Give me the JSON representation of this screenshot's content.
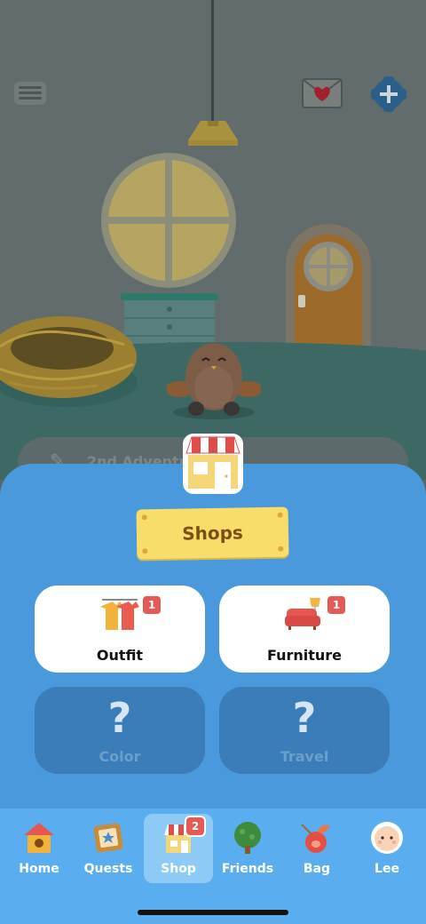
{
  "scene": {
    "adventure_text": "2nd Adventu"
  },
  "sheet": {
    "title": "Shops",
    "cards": [
      {
        "label": "Outfit",
        "badge": "1",
        "locked": false,
        "icon": "outfit-icon"
      },
      {
        "label": "Furniture",
        "badge": "1",
        "locked": false,
        "icon": "furniture-icon"
      },
      {
        "label": "Color",
        "locked": true,
        "icon": "question-icon"
      },
      {
        "label": "Travel",
        "locked": true,
        "icon": "question-icon"
      }
    ]
  },
  "tabbar": {
    "items": [
      {
        "label": "Home",
        "icon": "birdhouse-icon"
      },
      {
        "label": "Quests",
        "icon": "quest-board-icon"
      },
      {
        "label": "Shop",
        "icon": "shop-icon",
        "badge": "2",
        "active": true
      },
      {
        "label": "Friends",
        "icon": "tree-icon"
      },
      {
        "label": "Bag",
        "icon": "bag-icon"
      },
      {
        "label": "Lee",
        "icon": "avatar-icon"
      }
    ]
  },
  "colors": {
    "sheet_blue": "#4a99dc",
    "tabbar_blue": "#5aaef0",
    "sign_yellow": "#f8dd6b",
    "badge_red": "#e45a57"
  }
}
